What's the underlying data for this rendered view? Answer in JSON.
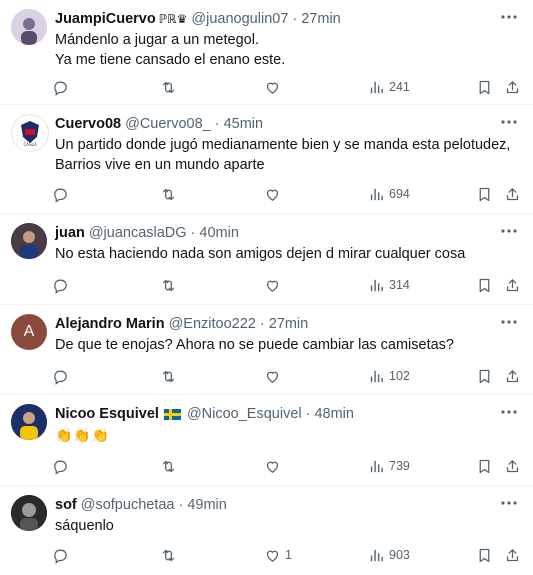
{
  "tweets": [
    {
      "name": "JuampiCuervo",
      "badge": "ℙℝ♛",
      "handle": "@juanogulin07",
      "time": "27min",
      "lines": [
        "Mándenlo a jugar a un metegol.",
        "Ya me tiene cansado el enano este."
      ],
      "likes": "",
      "views": "241",
      "avatar_letter": "",
      "avatar_color": "#c9c3d6"
    },
    {
      "name": "Cuervo08",
      "badge": "",
      "handle": "@Cuervo08_",
      "time": "45min",
      "lines": [
        "Un partido donde jugó medianamente bien y se manda esta pelotudez,",
        "Barrios vive en un mundo aparte"
      ],
      "likes": "",
      "views": "694",
      "avatar_letter": "",
      "avatar_color": "#ffffff"
    },
    {
      "name": "juan",
      "badge": "",
      "handle": "@juancaslaDG",
      "time": "40min",
      "lines": [
        "No esta haciendo nada son amigos dejen d mirar cualquer cosa"
      ],
      "likes": "",
      "views": "314",
      "avatar_letter": "",
      "avatar_color": "#3a2f3a"
    },
    {
      "name": "Alejandro Marin",
      "badge": "",
      "handle": "@Enzitoo222",
      "time": "27min",
      "lines": [
        "De que te enojas? Ahora no se puede cambiar las camisetas?"
      ],
      "likes": "",
      "views": "102",
      "avatar_letter": "A",
      "avatar_color": "#8a4b3e"
    },
    {
      "name": "Nicoo Esquivel",
      "badge": "",
      "handle": "@Nicoo_Esquivel",
      "time": "48min",
      "lines": [
        "👏👏👏"
      ],
      "likes": "",
      "views": "739",
      "avatar_letter": "",
      "avatar_color": "#1d2f6b"
    },
    {
      "name": "sof",
      "badge": "",
      "handle": "@sofpuchetaa",
      "time": "49min",
      "lines": [
        "sáquenlo"
      ],
      "likes": "1",
      "views": "903",
      "avatar_letter": "",
      "avatar_color": "#222222"
    }
  ],
  "colors": {
    "muted": "#536471",
    "border": "#eff3f4",
    "text": "#0f1419"
  },
  "icons": [
    "reply-icon",
    "retweet-icon",
    "like-icon",
    "views-icon",
    "bookmark-icon",
    "share-icon",
    "more-icon"
  ]
}
